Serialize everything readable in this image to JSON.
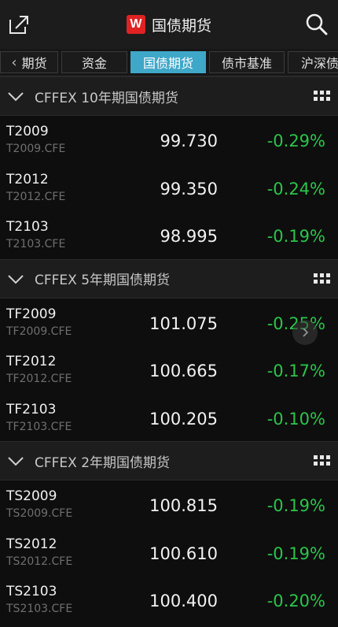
{
  "header": {
    "logo": "W",
    "title": "国债期货"
  },
  "tabs": [
    {
      "label": "期货",
      "active": false
    },
    {
      "label": "资金",
      "active": false
    },
    {
      "label": "国债期货",
      "active": true
    },
    {
      "label": "债市基准",
      "active": false
    },
    {
      "label": "沪深债",
      "active": false
    }
  ],
  "sections": [
    {
      "title": "CFFEX 10年期国债期货",
      "rows": [
        {
          "code": "T2009",
          "sub": "T2009.CFE",
          "price": "99.730",
          "change": "-0.29%"
        },
        {
          "code": "T2012",
          "sub": "T2012.CFE",
          "price": "99.350",
          "change": "-0.24%"
        },
        {
          "code": "T2103",
          "sub": "T2103.CFE",
          "price": "98.995",
          "change": "-0.19%"
        }
      ]
    },
    {
      "title": "CFFEX 5年期国债期货",
      "rows": [
        {
          "code": "TF2009",
          "sub": "TF2009.CFE",
          "price": "101.075",
          "change": "-0.25%"
        },
        {
          "code": "TF2012",
          "sub": "TF2012.CFE",
          "price": "100.665",
          "change": "-0.17%"
        },
        {
          "code": "TF2103",
          "sub": "TF2103.CFE",
          "price": "100.205",
          "change": "-0.10%"
        }
      ]
    },
    {
      "title": "CFFEX 2年期国债期货",
      "rows": [
        {
          "code": "TS2009",
          "sub": "TS2009.CFE",
          "price": "100.815",
          "change": "-0.19%"
        },
        {
          "code": "TS2012",
          "sub": "TS2012.CFE",
          "price": "100.610",
          "change": "-0.19%"
        },
        {
          "code": "TS2103",
          "sub": "TS2103.CFE",
          "price": "100.400",
          "change": "-0.20%"
        }
      ]
    }
  ],
  "colors": {
    "accent": "#3fa7c8",
    "down": "#2ac54a",
    "brand": "#e02222"
  }
}
